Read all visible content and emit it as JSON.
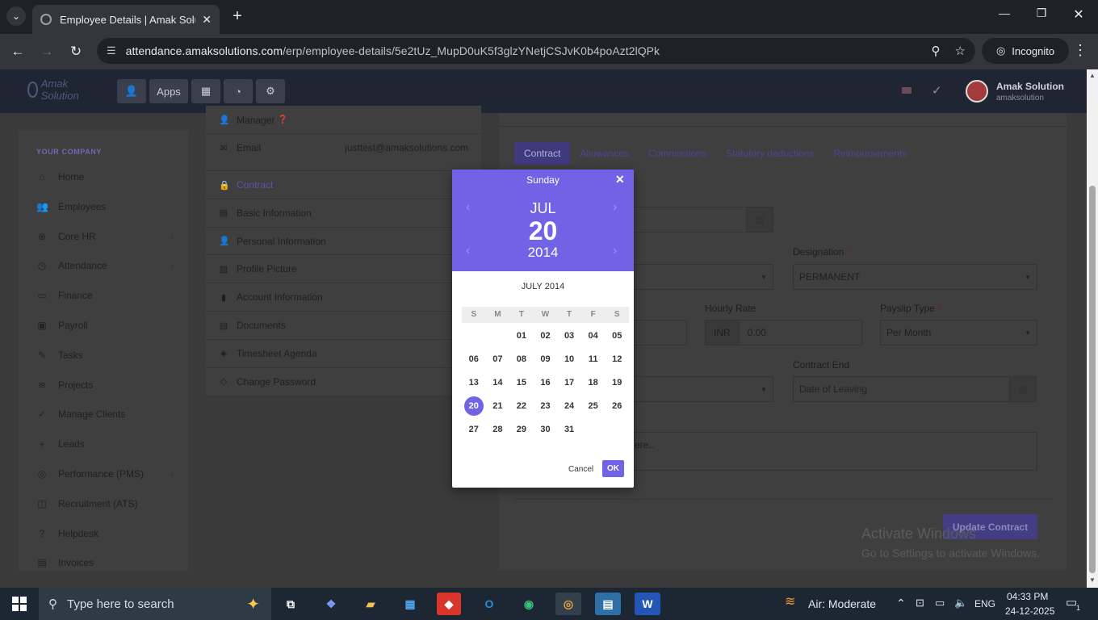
{
  "browser": {
    "tab_title": "Employee Details | Amak Soluti",
    "url_host": "attendance.amaksolutions.com",
    "url_path": "/erp/employee-details/5e2tUz_MupD0uK5f3glzYNetjCSJvK0b4poAzt2lQPk",
    "incognito_label": "Incognito"
  },
  "appbar": {
    "logo_text": "Amak Solution",
    "apps_label": "Apps",
    "user_name": "Amak Solution",
    "user_handle": "amaksolution"
  },
  "sidebar": {
    "heading": "YOUR COMPANY",
    "items": [
      {
        "label": "Home",
        "icon": "home-icon",
        "chevron": false
      },
      {
        "label": "Employees",
        "icon": "users-icon",
        "chevron": false
      },
      {
        "label": "Core HR",
        "icon": "globe-icon",
        "chevron": true
      },
      {
        "label": "Attendance",
        "icon": "clock-icon",
        "chevron": true
      },
      {
        "label": "Finance",
        "icon": "card-icon",
        "chevron": false
      },
      {
        "label": "Payroll",
        "icon": "payroll-icon",
        "chevron": false
      },
      {
        "label": "Tasks",
        "icon": "edit-icon",
        "chevron": false
      },
      {
        "label": "Projects",
        "icon": "layers-icon",
        "chevron": false
      },
      {
        "label": "Manage Clients",
        "icon": "user-check-icon",
        "chevron": false
      },
      {
        "label": "Leads",
        "icon": "user-plus-icon",
        "chevron": false
      },
      {
        "label": "Performance (PMS)",
        "icon": "gauge-icon",
        "chevron": true
      },
      {
        "label": "Recruitment (ATS)",
        "icon": "briefcase-icon",
        "chevron": false
      },
      {
        "label": "Helpdesk",
        "icon": "help-icon",
        "chevron": false
      },
      {
        "label": "Invoices",
        "icon": "invoice-icon",
        "chevron": false
      }
    ]
  },
  "profile_menu": {
    "manager_label": "Manager",
    "email_label": "Email",
    "email_value": "justtest@amaksolutions.com",
    "items": [
      "Contract",
      "Basic Information",
      "Personal Information",
      "Profile Picture",
      "Account Information",
      "Documents",
      "Timesheet Agenda",
      "Change Password"
    ]
  },
  "contract": {
    "tabs": [
      "Contract",
      "Allowances",
      "Commissions",
      "Statutory deductions",
      "Reimbursements"
    ],
    "designation_label": "Designation",
    "designation_value": "PERMANENT",
    "hourly_rate_label": "Hourly Rate",
    "currency": "INR",
    "hourly_rate_value": "0.00",
    "payslip_type_label": "Payslip Type",
    "payslip_type_value": "Per Month",
    "contract_end_label": "Contract End",
    "contract_end_placeholder": "Date of Leaving",
    "textarea_placeholder_tail": "ere..",
    "update_button": "Update Contract"
  },
  "watermark": {
    "line1": "Activate Windows",
    "line2": "Go to Settings to activate Windows."
  },
  "datepicker": {
    "weekday": "Sunday",
    "month_short": "JUL",
    "day": "20",
    "year": "2014",
    "caption": "JULY 2014",
    "weekday_initials": [
      "S",
      "M",
      "T",
      "W",
      "T",
      "F",
      "S"
    ],
    "selected_day": 20,
    "weeks": [
      [
        "",
        "",
        "01",
        "02",
        "03",
        "04",
        "05"
      ],
      [
        "06",
        "07",
        "08",
        "09",
        "10",
        "11",
        "12"
      ],
      [
        "13",
        "14",
        "15",
        "16",
        "17",
        "18",
        "19"
      ],
      [
        "20",
        "21",
        "22",
        "23",
        "24",
        "25",
        "26"
      ],
      [
        "27",
        "28",
        "29",
        "30",
        "31",
        "",
        ""
      ]
    ],
    "cancel_label": "Cancel",
    "ok_label": "OK"
  },
  "taskbar": {
    "search_placeholder": "Type here to search",
    "weather": "Air: Moderate",
    "language": "ENG",
    "time": "04:33 PM",
    "date": "24-12-2025",
    "notification_count": "1"
  }
}
